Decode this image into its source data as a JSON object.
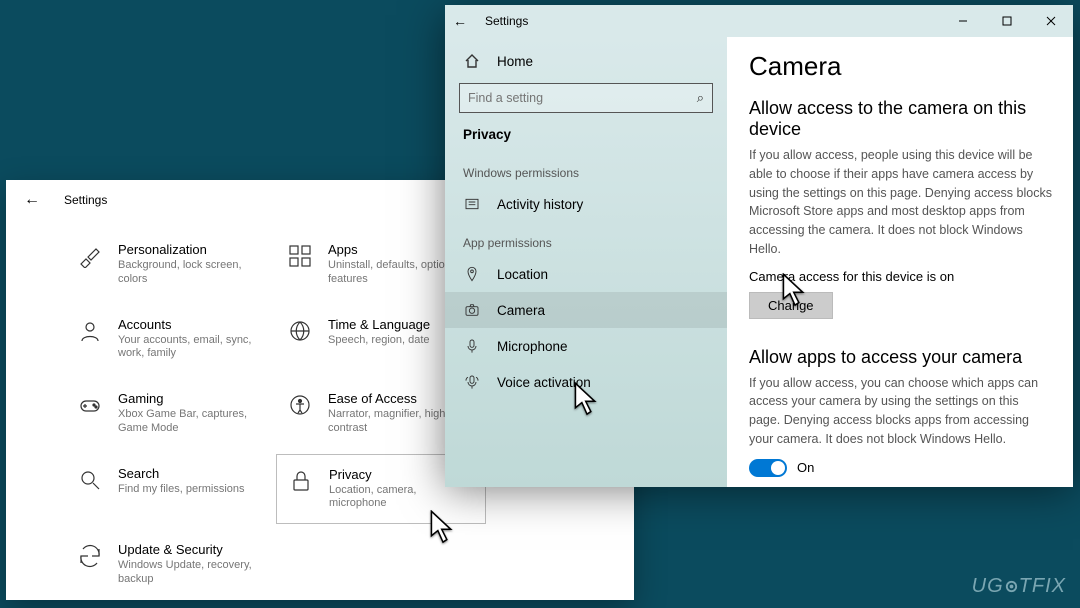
{
  "back_window": {
    "title": "Settings",
    "categories": [
      {
        "key": "personalization",
        "title": "Personalization",
        "sub": "Background, lock screen, colors",
        "icon": "brush"
      },
      {
        "key": "apps",
        "title": "Apps",
        "sub": "Uninstall, defaults, optional features",
        "icon": "grid"
      },
      {
        "key": "accounts",
        "title": "Accounts",
        "sub": "Your accounts, email, sync, work, family",
        "icon": "person"
      },
      {
        "key": "time",
        "title": "Time & Language",
        "sub": "Speech, region, date",
        "icon": "globe"
      },
      {
        "key": "gaming",
        "title": "Gaming",
        "sub": "Xbox Game Bar, captures, Game Mode",
        "icon": "game"
      },
      {
        "key": "ease",
        "title": "Ease of Access",
        "sub": "Narrator, magnifier, high contrast",
        "icon": "access"
      },
      {
        "key": "search",
        "title": "Search",
        "sub": "Find my files, permissions",
        "icon": "search"
      },
      {
        "key": "privacy",
        "title": "Privacy",
        "sub": "Location, camera, microphone",
        "icon": "lock",
        "selected": true
      },
      {
        "key": "update",
        "title": "Update & Security",
        "sub": "Windows Update, recovery, backup",
        "icon": "sync"
      }
    ]
  },
  "front_window": {
    "title": "Settings",
    "home_label": "Home",
    "search_placeholder": "Find a setting",
    "category_label": "Privacy",
    "section_win": "Windows permissions",
    "section_app": "App permissions",
    "nav_win": [
      {
        "key": "activity",
        "label": "Activity history",
        "icon": "history"
      }
    ],
    "nav_app": [
      {
        "key": "location",
        "label": "Location",
        "icon": "pin"
      },
      {
        "key": "camera",
        "label": "Camera",
        "icon": "camera",
        "selected": true
      },
      {
        "key": "microphone",
        "label": "Microphone",
        "icon": "mic"
      },
      {
        "key": "voice",
        "label": "Voice activation",
        "icon": "voice"
      }
    ],
    "content": {
      "heading": "Camera",
      "h2a": "Allow access to the camera on this device",
      "desc_a": "If you allow access, people using this device will be able to choose if their apps have camera access by using the settings on this page. Denying access blocks Microsoft Store apps and most desktop apps from accessing the camera. It does not block Windows Hello.",
      "status": "Camera access for this device is on",
      "change_btn": "Change",
      "h2b": "Allow apps to access your camera",
      "desc_b": "If you allow access, you can choose which apps can access your camera by using the settings on this page. Denying access blocks apps from accessing your camera. It does not block Windows Hello.",
      "toggle_label": "On"
    }
  },
  "watermark": "UGETFIX"
}
